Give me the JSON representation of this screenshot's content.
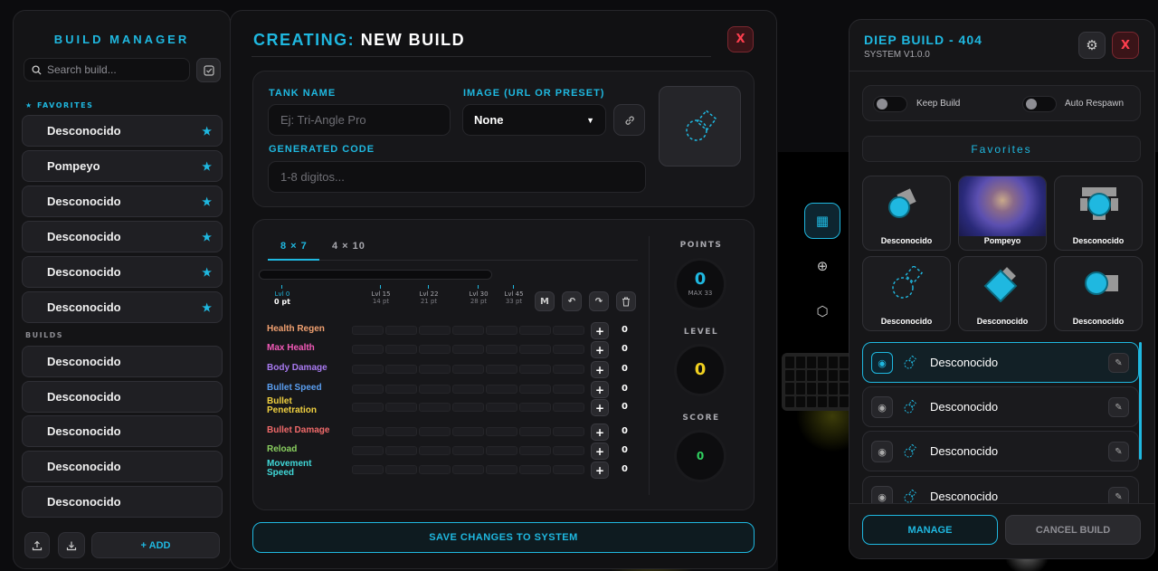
{
  "left": {
    "title": "BUILD MANAGER",
    "search_placeholder": "Search build...",
    "favorites_label": "★ FAVORITES",
    "builds_label": "BUILDS",
    "favorites": [
      {
        "name": "Desconocido"
      },
      {
        "name": "Pompeyo"
      },
      {
        "name": "Desconocido"
      },
      {
        "name": "Desconocido"
      },
      {
        "name": "Desconocido"
      },
      {
        "name": "Desconocido"
      }
    ],
    "builds": [
      {
        "name": "Desconocido"
      },
      {
        "name": "Desconocido"
      },
      {
        "name": "Desconocido"
      },
      {
        "name": "Desconocido"
      },
      {
        "name": "Desconocido"
      }
    ],
    "add_label": "+ ADD"
  },
  "center": {
    "title_prefix": "CREATING:",
    "title_main": "NEW BUILD",
    "close_label": "X",
    "tank_name_label": "TANK NAME",
    "tank_name_placeholder": "Ej: Tri-Angle Pro",
    "image_label": "IMAGE (URL OR PRESET)",
    "image_value": "None",
    "code_label": "GENERATED CODE",
    "code_placeholder": "1-8 digitos...",
    "tabs": [
      "8 × 7",
      "4 × 10"
    ],
    "active_tab": 0,
    "levels": [
      {
        "level": "Lvl 0",
        "points": "0 pt"
      },
      {
        "level": "Lvl 15",
        "points": "14 pt"
      },
      {
        "level": "Lvl 22",
        "points": "21 pt"
      },
      {
        "level": "Lvl 30",
        "points": "28 pt"
      },
      {
        "level": "Lvl 45",
        "points": "33 pt"
      }
    ],
    "tool_m": "M",
    "stats": [
      {
        "name": "Health Regen",
        "value": "0",
        "color": "#f0a070"
      },
      {
        "name": "Max Health",
        "value": "0",
        "color": "#f25ab8"
      },
      {
        "name": "Body Damage",
        "value": "0",
        "color": "#a87af0"
      },
      {
        "name": "Bullet Speed",
        "value": "0",
        "color": "#5a9ef0"
      },
      {
        "name": "Bullet Penetration",
        "value": "0",
        "color": "#f0d040"
      },
      {
        "name": "Bullet Damage",
        "value": "0",
        "color": "#f06a6a"
      },
      {
        "name": "Reload",
        "value": "0",
        "color": "#8ad060"
      },
      {
        "name": "Movement Speed",
        "value": "0",
        "color": "#40d8d8"
      }
    ],
    "plus_label": "+",
    "points_label": "POINTS",
    "points_value": "0",
    "points_max": "MAX 33",
    "level_label": "LEVEL",
    "level_value": "0",
    "score_label": "SCORE",
    "score_value": "0",
    "save_label": "SAVE CHANGES TO SYSTEM",
    "accent": "#1fb8e0"
  },
  "right": {
    "title": "DIEP BUILD - 404",
    "subtitle": "SYSTEM V1.0.0",
    "close_label": "X",
    "keep_build": "Keep Build",
    "auto_respawn": "Auto Respawn",
    "favorites_label": "Favorites",
    "tiles": [
      {
        "name": "Desconocido",
        "icon": "tank-sniper-icon"
      },
      {
        "name": "Pompeyo",
        "icon": "photo"
      },
      {
        "name": "Desconocido",
        "icon": "tank-quad-icon"
      },
      {
        "name": "Desconocido",
        "icon": "tank-outline-icon"
      },
      {
        "name": "Desconocido",
        "icon": "tank-square-icon"
      },
      {
        "name": "Desconocido",
        "icon": "tank-machine-icon"
      }
    ],
    "rows": [
      {
        "name": "Desconocido",
        "active": true
      },
      {
        "name": "Desconocido",
        "active": false
      },
      {
        "name": "Desconocido",
        "active": false
      },
      {
        "name": "Desconocido",
        "active": false
      }
    ],
    "manage_label": "MANAGE",
    "cancel_label": "CANCEL BUILD"
  }
}
